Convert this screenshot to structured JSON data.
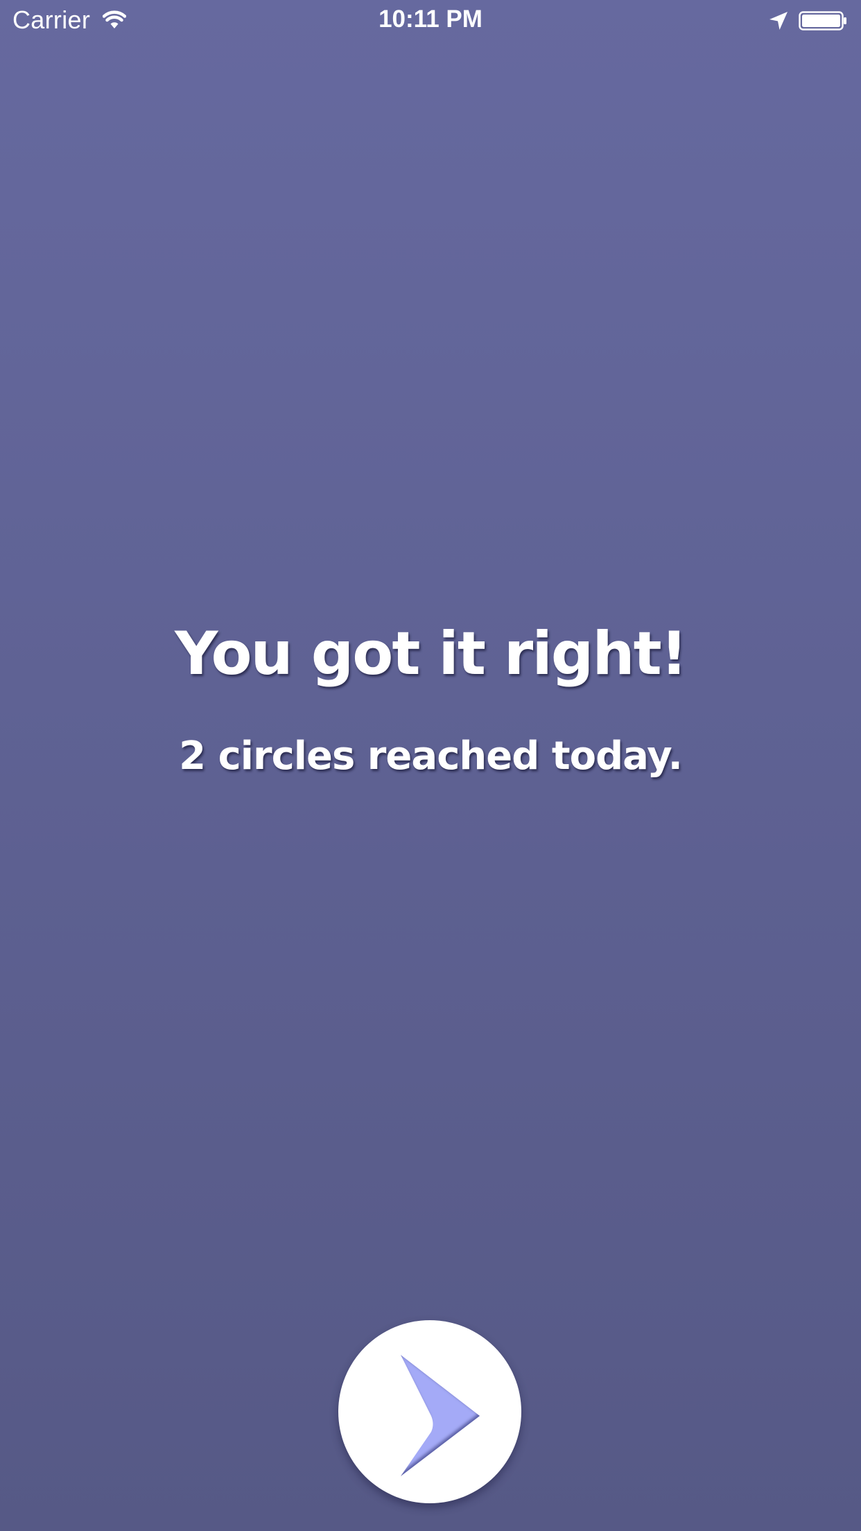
{
  "status_bar": {
    "carrier": "Carrier",
    "time": "10:11 PM",
    "icons": [
      "wifi-icon",
      "location-arrow-icon",
      "battery-icon"
    ]
  },
  "message": {
    "headline": "You got it right!",
    "subline": "2 circles reached today."
  },
  "next_button": {
    "icon": "chevron-right-icon",
    "icon_color": "#a4aaf7"
  },
  "colors": {
    "background_top": "#66699f",
    "background_bottom": "#565986",
    "text": "#ffffff",
    "button": "#ffffff"
  }
}
